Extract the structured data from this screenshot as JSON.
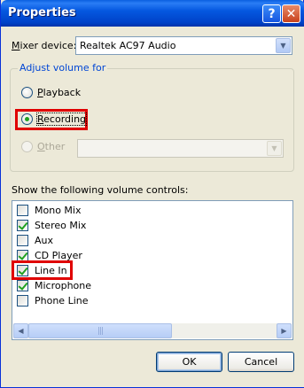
{
  "window": {
    "title": "Properties",
    "help_glyph": "?",
    "close_glyph": "✕"
  },
  "mixer": {
    "label_pre": "",
    "label_u": "M",
    "label_post": "ixer device:",
    "value": "Realtek AC97 Audio"
  },
  "adjust_group": {
    "title": "Adjust volume for"
  },
  "radios": {
    "playback": {
      "u": "P",
      "rest": "layback",
      "checked": false
    },
    "recording": {
      "u": "R",
      "rest": "ecording",
      "checked": true
    },
    "other": {
      "u": "O",
      "rest": "ther",
      "checked": false,
      "disabled": true
    }
  },
  "controls_label": "Show the following volume controls:",
  "controls": [
    {
      "label": "Mono Mix",
      "checked": false
    },
    {
      "label": "Stereo Mix",
      "checked": true
    },
    {
      "label": "Aux",
      "checked": false
    },
    {
      "label": "CD Player",
      "checked": true
    },
    {
      "label": "Line In",
      "checked": true
    },
    {
      "label": "Microphone",
      "checked": true
    },
    {
      "label": "Phone Line",
      "checked": false
    }
  ],
  "buttons": {
    "ok": "OK",
    "cancel": "Cancel"
  },
  "colors": {
    "title_bar": "#0558e0",
    "highlight": "#e00000",
    "group_title": "#0046d5"
  }
}
